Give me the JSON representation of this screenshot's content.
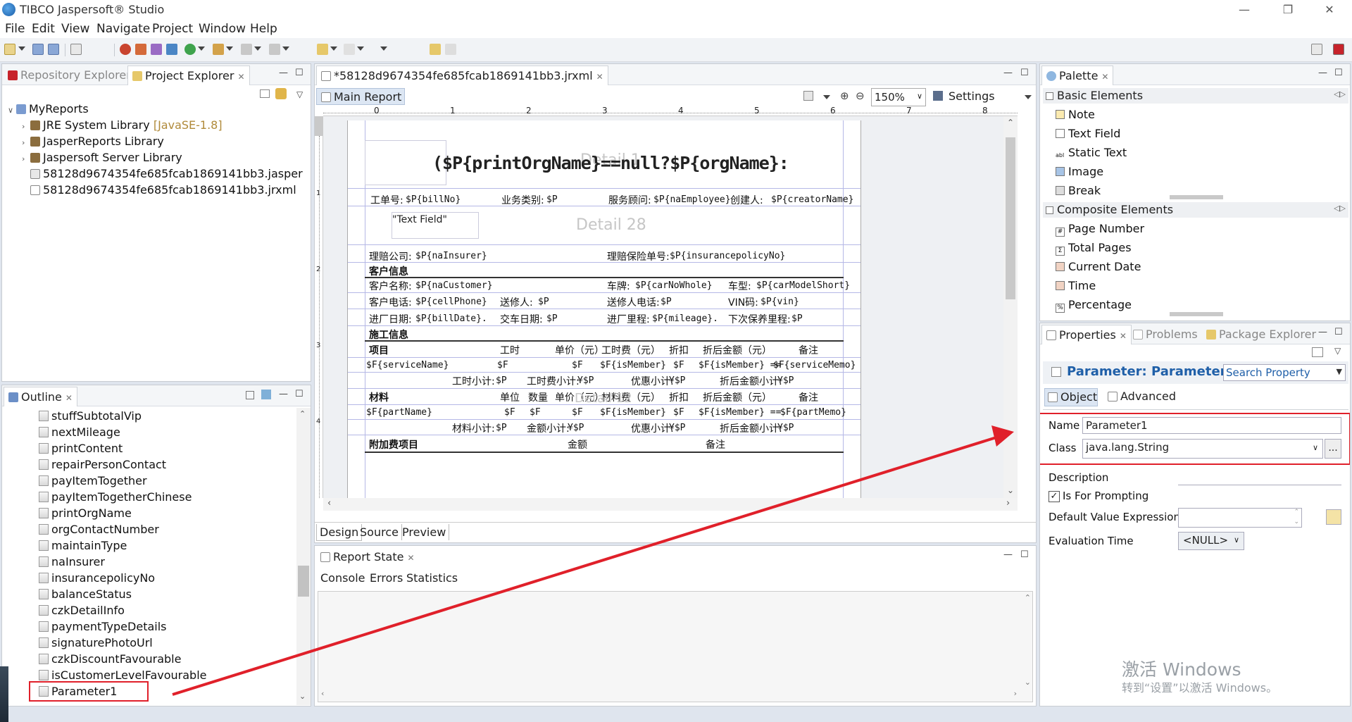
{
  "window": {
    "title": "TIBCO Jaspersoft® Studio"
  },
  "menu": [
    "File",
    "Edit",
    "View",
    "Navigate",
    "Project",
    "Window",
    "Help"
  ],
  "left_top": {
    "tabs": [
      {
        "label": "Repository Explorer"
      },
      {
        "label": "Project Explorer"
      }
    ],
    "tree": [
      {
        "label": "MyReports",
        "suffix": ""
      },
      {
        "label": "JRE System Library",
        "suffix": "[JavaSE-1.8]"
      },
      {
        "label": "JasperReports Library",
        "suffix": ""
      },
      {
        "label": "Jaspersoft Server Library",
        "suffix": ""
      },
      {
        "label": "58128d9674354fe685fcab1869141bb3.jasper",
        "suffix": ""
      },
      {
        "label": "58128d9674354fe685fcab1869141bb3.jrxml",
        "suffix": ""
      }
    ]
  },
  "outline": {
    "tab": "Outline",
    "items": [
      "stuffSubtotalVip",
      "nextMileage",
      "printContent",
      "repairPersonContact",
      "payItemTogether",
      "payItemTogetherChinese",
      "printOrgName",
      "orgContactNumber",
      "maintainType",
      "naInsurer",
      "insurancepolicyNo",
      "balanceStatus",
      "czkDetailInfo",
      "paymentTypeDetails",
      "signaturePhotoUrl",
      "czkDiscountFavourable",
      "isCustomerLevelFavourable",
      "Parameter1"
    ]
  },
  "editor": {
    "file_tab": "*58128d9674354fe685fcab1869141bb3.jrxml",
    "main_report": "Main Report",
    "zoom": "150%",
    "settings": "Settings",
    "ruler": [
      "0",
      "1",
      "2",
      "3",
      "4",
      "5",
      "6",
      "7",
      "8"
    ],
    "vruler": [
      "1",
      "2",
      "3",
      "4"
    ],
    "title_expr": "($P{printOrgName}==null?$P{orgName}:",
    "ghost_title": "Detail 1",
    "ghost_detail28": "Detail 28",
    "ghost_detail12": "Detail 12",
    "text_field": "\"Text Field\"",
    "row1": [
      "工单号:",
      "$P{billNo}",
      "业务类别:",
      "$P",
      "服务顾问:",
      "$P{naEmployee}",
      "创建人:",
      "$P{creatorName}"
    ],
    "row2": [
      "理赔公司:",
      "$P{naInsurer}",
      "理赔保险单号:",
      "$P{insurancepolicyNo}"
    ],
    "sec_customer": "客户信息",
    "row3": [
      "客户名称:",
      "$P{naCustomer}",
      "车牌:",
      "$P{carNoWhole}",
      "车型:",
      "$P{carModelShort}"
    ],
    "row4": [
      "客户电话:",
      "$P{cellPhone}",
      "送修人:",
      "$P",
      "送修人电话:",
      "$P",
      "VIN码:",
      "$P{vin}"
    ],
    "row5": [
      "进厂日期:",
      "$P{billDate}.",
      "交车日期:",
      "$P",
      "进厂里程:",
      "$P{mileage}.",
      "下次保养里程:",
      "$P"
    ],
    "sec_work": "施工信息",
    "hdr_work": [
      "项目",
      "工时",
      "单价（元）",
      "工时费（元）",
      "折扣",
      "折后金额（元）",
      "备注"
    ],
    "row_work": [
      "$F{serviceName}",
      "$F",
      "$F",
      "$F{isMember}",
      "$F",
      "$F{isMember} ==",
      "$F{serviceMemo}"
    ],
    "sub_work": [
      "工时小计:",
      "$P",
      "工时费小计:",
      "¥$P",
      "优惠小计:",
      "¥$P",
      "折后金额小计:",
      "¥$P"
    ],
    "hdr_mat": [
      "材料",
      "单位",
      "数量",
      "单价（元）",
      "材料费（元）",
      "折扣",
      "折后金额（元）",
      "备注"
    ],
    "row_mat": [
      "$F{partName}",
      "$F",
      "$F",
      "$F",
      "$F{isMember}",
      "$F",
      "$F{isMember} ==",
      "$F{partMemo}"
    ],
    "sub_mat": [
      "材料小计:",
      "$P",
      "金额小计:",
      "¥$P",
      "优惠小计:",
      "¥$P",
      "折后金额小计:",
      "¥$P"
    ],
    "hdr_extra": [
      "附加费项目",
      "金额",
      "备注"
    ],
    "bottom_tabs": [
      "Design",
      "Source",
      "Preview"
    ]
  },
  "report_state": {
    "tab": "Report State",
    "subtabs": [
      "Console",
      "Errors",
      "Statistics"
    ]
  },
  "palette": {
    "tab": "Palette",
    "basic": "Basic Elements",
    "basic_items": [
      "Note",
      "Text Field",
      "Static Text",
      "Image",
      "Break"
    ],
    "composite": "Composite Elements",
    "composite_items": [
      "Page Number",
      "Total Pages",
      "Current Date",
      "Time",
      "Percentage"
    ]
  },
  "properties": {
    "tabs": [
      {
        "label": "Properties"
      },
      {
        "label": "Problems"
      },
      {
        "label": "Package Explorer"
      }
    ],
    "header": "Parameter: Parameter1",
    "search": "Search Property",
    "subtabs": [
      "Object",
      "Advanced"
    ],
    "name_label": "Name",
    "name_value": "Parameter1",
    "class_label": "Class",
    "class_value": "java.lang.String",
    "class_btn": "...",
    "description_label": "Description",
    "prompting_label": "Is For Prompting",
    "prompting_checked": true,
    "default_label": "Default Value Expression",
    "eval_label": "Evaluation Time",
    "eval_value": "<NULL>"
  },
  "watermark": {
    "line1": "激活 Windows",
    "line2": "转到“设置”以激活 Windows。"
  },
  "colors": {
    "annotation_red": "#e0202a",
    "header_blue": "#1f5fa8"
  }
}
